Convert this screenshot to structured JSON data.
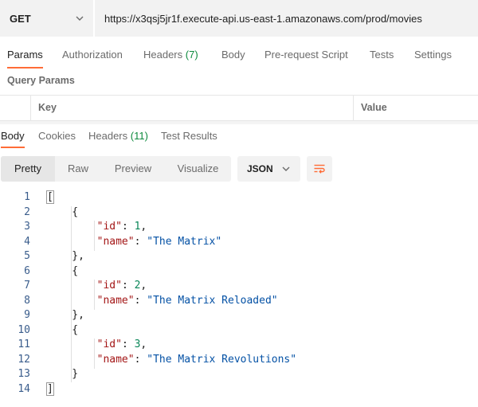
{
  "request": {
    "method": "GET",
    "url": "https://x3qsj5jr1f.execute-api.us-east-1.amazonaws.com/prod/movies"
  },
  "request_tabs": [
    {
      "label": "Params",
      "active": true
    },
    {
      "label": "Authorization"
    },
    {
      "label": "Headers",
      "count": "(7)"
    },
    {
      "label": "Body"
    },
    {
      "label": "Pre-request Script"
    },
    {
      "label": "Tests"
    },
    {
      "label": "Settings"
    }
  ],
  "query_params": {
    "title": "Query Params",
    "columns": [
      "Key",
      "Value"
    ]
  },
  "response_tabs": [
    {
      "label": "Body",
      "active": true
    },
    {
      "label": "Cookies"
    },
    {
      "label": "Headers",
      "count": "(11)"
    },
    {
      "label": "Test Results"
    }
  ],
  "view_modes": [
    "Pretty",
    "Raw",
    "Preview",
    "Visualize"
  ],
  "format": "JSON",
  "icons": {
    "method_dropdown": "chevron-down-icon",
    "format_dropdown": "chevron-down-icon",
    "wrap": "wrap-lines-icon"
  },
  "colors": {
    "accent": "#ff6c37",
    "count": "#0d8a3d",
    "json_key": "#a31515",
    "json_string": "#0451a5",
    "json_number": "#098658",
    "line_number": "#3a5d8c"
  },
  "response_body": [
    {
      "n": "1",
      "parts": [
        [
          "p",
          "["
        ]
      ]
    },
    {
      "n": "2",
      "parts": [
        [
          "p",
          "    {"
        ]
      ]
    },
    {
      "n": "3",
      "parts": [
        [
          "p",
          "        "
        ],
        [
          "key",
          "\"id\""
        ],
        [
          "p",
          ": "
        ],
        [
          "num",
          "1"
        ],
        [
          "p",
          ","
        ]
      ]
    },
    {
      "n": "4",
      "parts": [
        [
          "p",
          "        "
        ],
        [
          "key",
          "\"name\""
        ],
        [
          "p",
          ": "
        ],
        [
          "str",
          "\"The Matrix\""
        ]
      ]
    },
    {
      "n": "5",
      "parts": [
        [
          "p",
          "    },"
        ]
      ]
    },
    {
      "n": "6",
      "parts": [
        [
          "p",
          "    {"
        ]
      ]
    },
    {
      "n": "7",
      "parts": [
        [
          "p",
          "        "
        ],
        [
          "key",
          "\"id\""
        ],
        [
          "p",
          ": "
        ],
        [
          "num",
          "2"
        ],
        [
          "p",
          ","
        ]
      ]
    },
    {
      "n": "8",
      "parts": [
        [
          "p",
          "        "
        ],
        [
          "key",
          "\"name\""
        ],
        [
          "p",
          ": "
        ],
        [
          "str",
          "\"The Matrix Reloaded\""
        ]
      ]
    },
    {
      "n": "9",
      "parts": [
        [
          "p",
          "    },"
        ]
      ]
    },
    {
      "n": "10",
      "parts": [
        [
          "p",
          "    {"
        ]
      ]
    },
    {
      "n": "11",
      "parts": [
        [
          "p",
          "        "
        ],
        [
          "key",
          "\"id\""
        ],
        [
          "p",
          ": "
        ],
        [
          "num",
          "3"
        ],
        [
          "p",
          ","
        ]
      ]
    },
    {
      "n": "12",
      "parts": [
        [
          "p",
          "        "
        ],
        [
          "key",
          "\"name\""
        ],
        [
          "p",
          ": "
        ],
        [
          "str",
          "\"The Matrix Revolutions\""
        ]
      ]
    },
    {
      "n": "13",
      "parts": [
        [
          "p",
          "    }"
        ]
      ]
    },
    {
      "n": "14",
      "parts": [
        [
          "p",
          "]"
        ]
      ]
    }
  ]
}
